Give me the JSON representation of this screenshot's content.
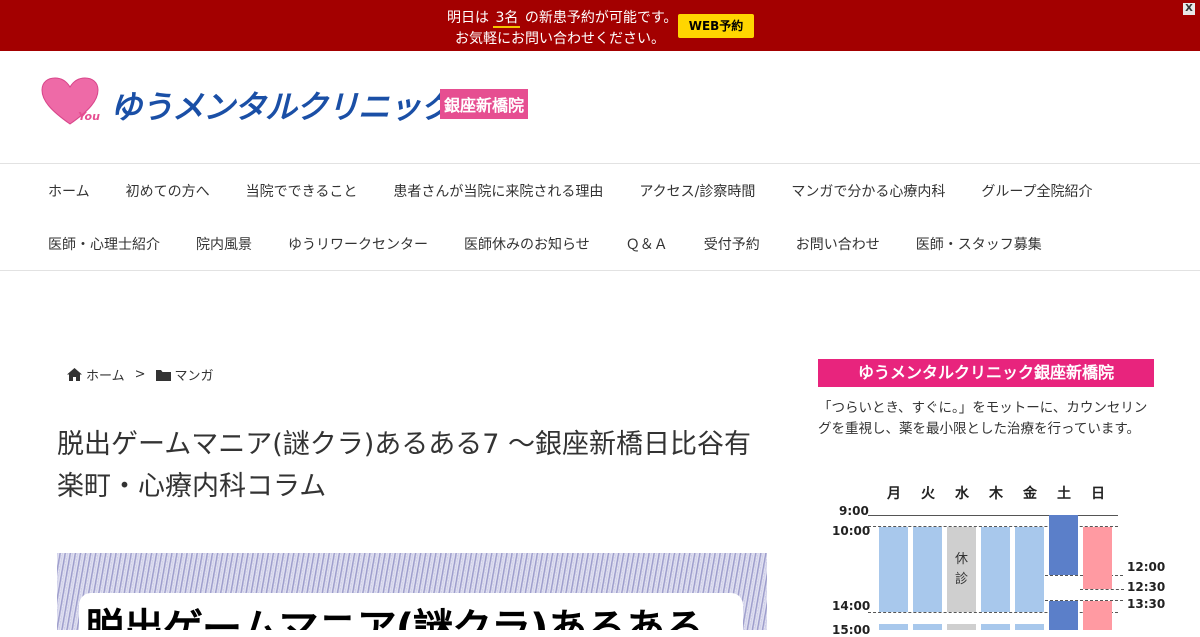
{
  "banner": {
    "line1_pre": "明日は",
    "line1_count": "3名",
    "line1_post": "の新患予約が可能です。",
    "line2": "お気軽にお問い合わせください。",
    "web_button": "WEB予約",
    "close": "X"
  },
  "logo": {
    "you": "You",
    "name": "ゆうメンタルクリニック",
    "branch": "銀座新橋院"
  },
  "nav": {
    "row1": [
      "ホーム",
      "初めての方へ",
      "当院でできること",
      "患者さんが当院に来院される理由",
      "アクセス/診察時間",
      "マンガで分かる心療内科",
      "グループ全院紹介"
    ],
    "row2": [
      "医師・心理士紹介",
      "院内風景",
      "ゆうリワークセンター",
      "医師休みのお知らせ",
      "Ｑ＆Ａ",
      "受付予約",
      "お問い合わせ",
      "医師・スタッフ募集"
    ]
  },
  "breadcrumb": {
    "home": "ホーム",
    "separator": ">",
    "category": "マンガ"
  },
  "article": {
    "title": "脱出ゲームマニア(謎クラ)あるある7 ～銀座新橋日比谷有楽町・心療内科コラム",
    "hero_text": "脱出ゲームマニア(謎クラ)あるある"
  },
  "sidebar": {
    "heading": "ゆうメンタルクリニック銀座新橋院",
    "description": "「つらいとき、すぐに。」をモットーに、カウンセリングを重視し、薬を最小限とした治療を行っています。"
  },
  "schedule": {
    "days": [
      "月",
      "火",
      "水",
      "木",
      "金",
      "土",
      "日"
    ],
    "times_left": [
      "9:00",
      "10:00",
      "14:00",
      "15:00"
    ],
    "times_right": [
      "12:00",
      "12:30",
      "13:30"
    ],
    "closed_label": "休診",
    "colors": {
      "weekday": "#a8c8ec",
      "closed": "#cfcfcf",
      "saturday": "#5b7fc9",
      "sunday": "#ff9aa2"
    }
  }
}
